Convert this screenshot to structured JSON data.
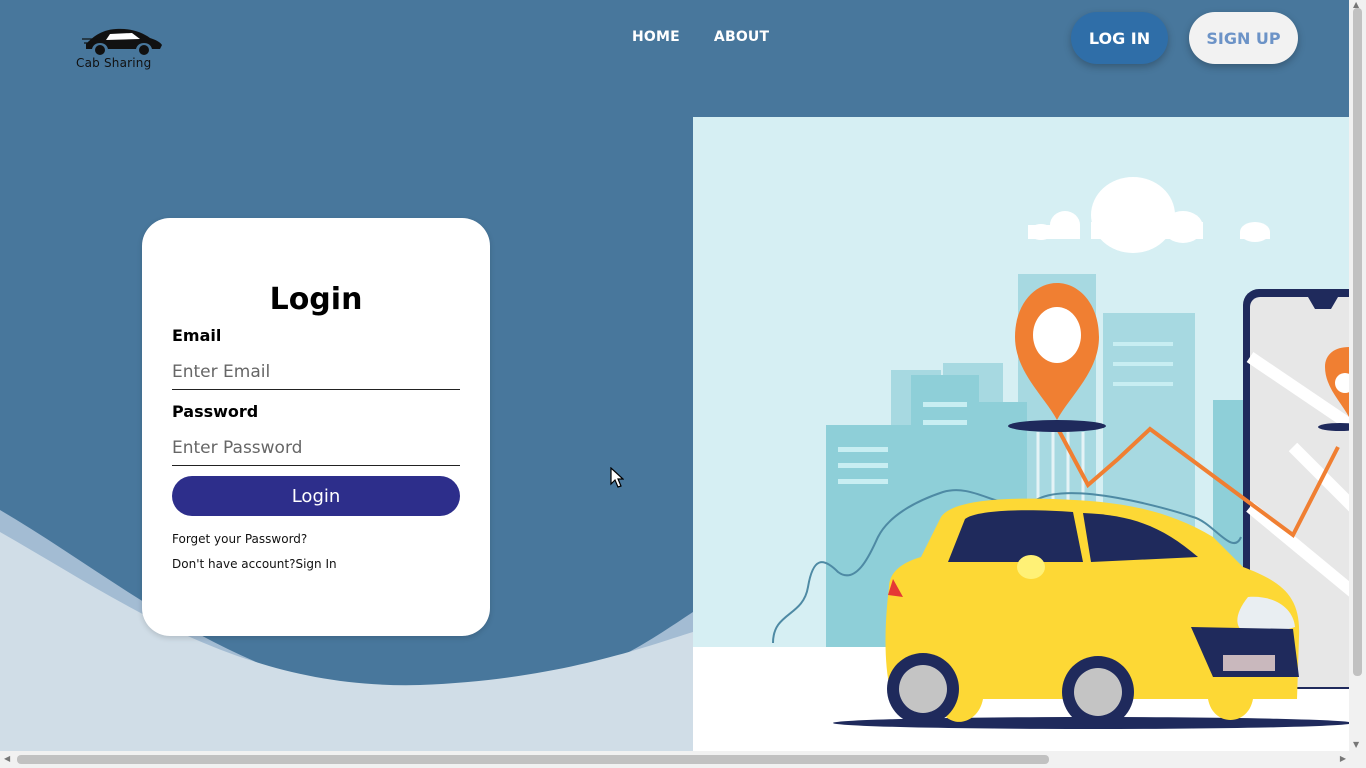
{
  "brand": {
    "logo_text": "Cab Sharing"
  },
  "nav": {
    "home": "HOME",
    "about": "ABOUT"
  },
  "header_buttons": {
    "login": "LOG IN",
    "signup": "SIGN UP"
  },
  "login_form": {
    "title": "Login",
    "email_label": "Email",
    "email_placeholder": "Enter Email",
    "password_label": "Password",
    "password_placeholder": "Enter Password",
    "submit_label": "Login",
    "forgot_password": "Forget your Password?",
    "no_account_text": "Don't have account?",
    "sign_in_link": "Sign In"
  },
  "colors": {
    "background": "#48779c",
    "submit_button": "#2d2e8b",
    "header_login_button": "#2f6ea8",
    "header_signup_text": "#6c93c7",
    "car": "#fdd835",
    "pin": "#f07f32"
  }
}
